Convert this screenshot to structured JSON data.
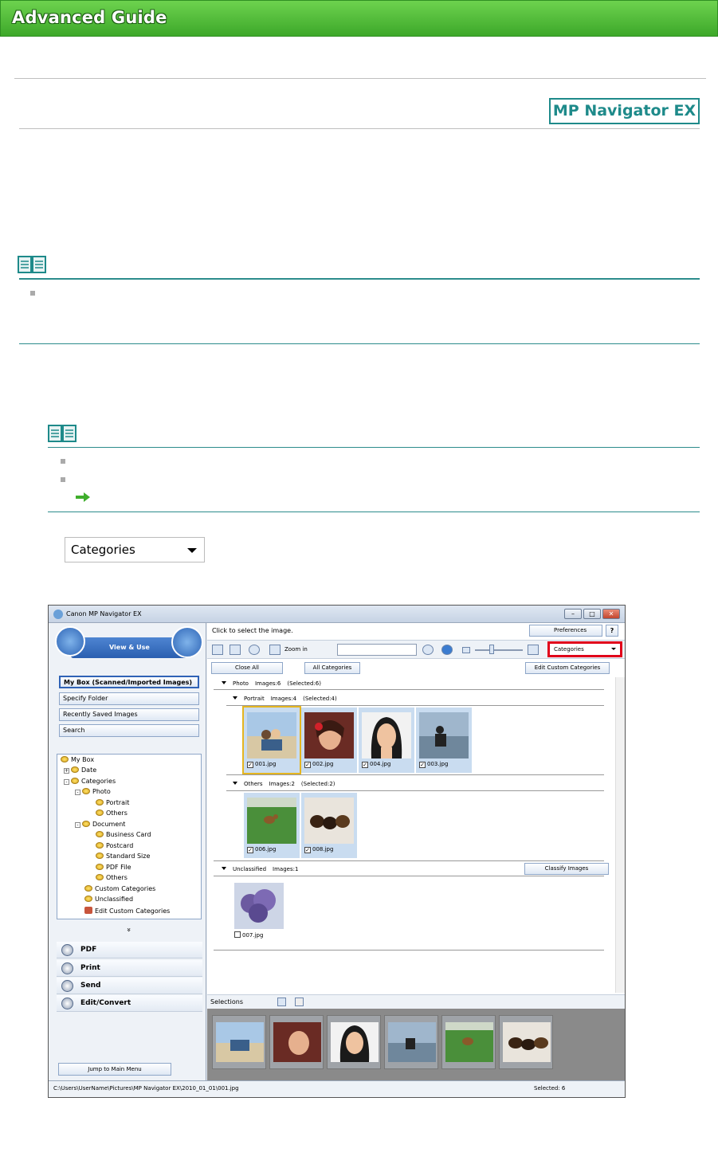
{
  "banner": {
    "title": "Advanced Guide"
  },
  "app_badge": "MP Navigator EX",
  "categories_select": {
    "value": "Categories"
  },
  "window": {
    "title": "Canon MP Navigator EX",
    "minimize": "–",
    "maximize": "□",
    "close": "✕",
    "mode_label": "View & Use",
    "nav_buttons": [
      "My Box (Scanned/Imported Images)",
      "Specify Folder",
      "Recently Saved Images",
      "Search"
    ],
    "tree": {
      "my_box": "My Box",
      "date": "Date",
      "categories": "Categories",
      "photo": "Photo",
      "portrait": "Portrait",
      "others": "Others",
      "document": "Document",
      "business_card": "Business Card",
      "postcard": "Postcard",
      "standard_size": "Standard Size",
      "pdf_file": "PDF File",
      "doc_others": "Others",
      "custom_categories": "Custom Categories",
      "unclassified": "Unclassified",
      "edit_custom_categories": "Edit Custom Categories"
    },
    "collapse_glyph": "»",
    "actions": [
      "PDF",
      "Print",
      "Send",
      "Edit/Convert"
    ],
    "jump_button": "Jump to Main Menu",
    "hint": "Click to select the image.",
    "preferences": "Preferences",
    "help": "?",
    "zoom_label": "Zoom in",
    "sort_value": "Categories",
    "close_all": "Close All",
    "all_categories": "All Categories",
    "edit_custom_categories_btn": "Edit Custom Categories",
    "groups": {
      "photo": {
        "name": "Photo",
        "images": "Images:6",
        "selected": "(Selected:6)"
      },
      "portrait": {
        "name": "Portrait",
        "images": "Images:4",
        "selected": "(Selected:4)"
      },
      "others": {
        "name": "Others",
        "images": "Images:2",
        "selected": "(Selected:2)"
      },
      "unclassified": {
        "name": "Unclassified",
        "images": "Images:1"
      }
    },
    "classify_button": "Classify Images",
    "thumbs": {
      "t001": "001.jpg",
      "t002": "002.jpg",
      "t004": "004.jpg",
      "t003": "003.jpg",
      "t006": "006.jpg",
      "t008": "008.jpg",
      "t007": "007.jpg"
    },
    "check_mark": "✓",
    "selections_label": "Selections",
    "status_path": "C:\\Users\\UserName\\Pictures\\MP Navigator EX\\2010_01_01\\001.jpg",
    "status_selected": "Selected: 6"
  },
  "colors": {
    "banner": "#4cb834",
    "teal": "#1e8a8a",
    "highlight_red": "#e1001a",
    "selected_outline": "#e5b520"
  }
}
